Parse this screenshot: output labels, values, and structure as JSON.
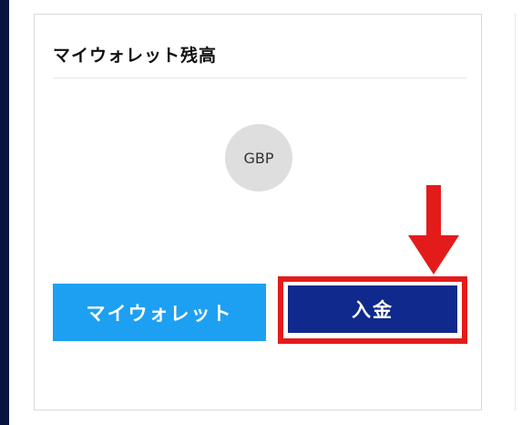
{
  "wallet_card": {
    "title": "マイウォレット残高",
    "currency_code": "GBP",
    "wallet_button_label": "マイウォレット",
    "deposit_button_label": "入金"
  },
  "annotation": {
    "highlight_color": "#e41b1b"
  },
  "colors": {
    "wallet_button": "#1da0f2",
    "deposit_button": "#0f2a8c",
    "sidebar": "#0a1440"
  }
}
